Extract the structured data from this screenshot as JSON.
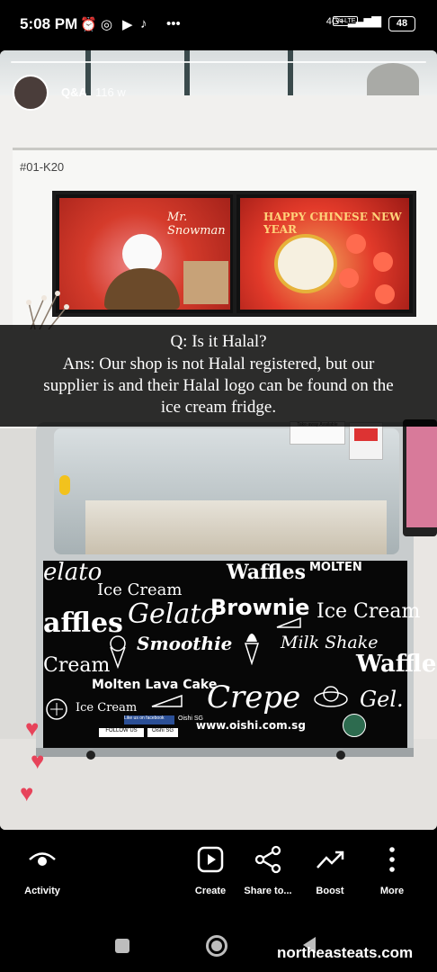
{
  "status_bar": {
    "time": "5:08 PM",
    "network": "4G+",
    "volte": "Vo LTE",
    "battery": "48"
  },
  "story": {
    "handle": "Q&A",
    "age": "116 w",
    "shop_code": "#01-K20",
    "tv_left_text": "Mr. Snowman",
    "tv_right_text": "HAPPY CHINESE NEW YEAR",
    "caption": {
      "question": "Q: Is it Halal?",
      "answer_1": "Ans: Our shop is not Halal registered, but our",
      "answer_2": "supplier is and their Halal logo can be found on the",
      "answer_3": "ice cream fridge."
    },
    "takeaway_sign": "Take-away Available",
    "fridge_words": {
      "gelato_1": "elato",
      "ice_cream_1": "Ice Cream",
      "waffles_1": "Waffles",
      "molten_1": "MOLTEN",
      "waffles_2": "affles",
      "gelato_2": "Gelato",
      "brownie": "Brownie",
      "ice_cream_2": "Ice Cream",
      "smoothie": "Smoothie",
      "milk_shake": "Milk Shake",
      "cream_3": "Cream",
      "molten_lava": "Molten Lava Cake",
      "waffle_3": "Waffle",
      "ice_cream_4": "Ice Cream",
      "crepe": "Crepe",
      "gel": "Gel.",
      "facebook_label": "Like us on facebook",
      "facebook_name": "Oishi SG",
      "instagram_label": "FOLLOW US",
      "instagram_name": "Oishi SG",
      "website": "www.oishi.com.sg"
    }
  },
  "actions": [
    {
      "label": "Activity",
      "icon": "eye-icon"
    },
    {
      "label": "Create",
      "icon": "create-icon"
    },
    {
      "label": "Share to...",
      "icon": "share-icon"
    },
    {
      "label": "Boost",
      "icon": "boost-icon"
    },
    {
      "label": "More",
      "icon": "more-icon"
    }
  ],
  "watermark": "northeasteats.com",
  "colors": {
    "heart": "#e7435a",
    "caption_bg": "#000000"
  }
}
